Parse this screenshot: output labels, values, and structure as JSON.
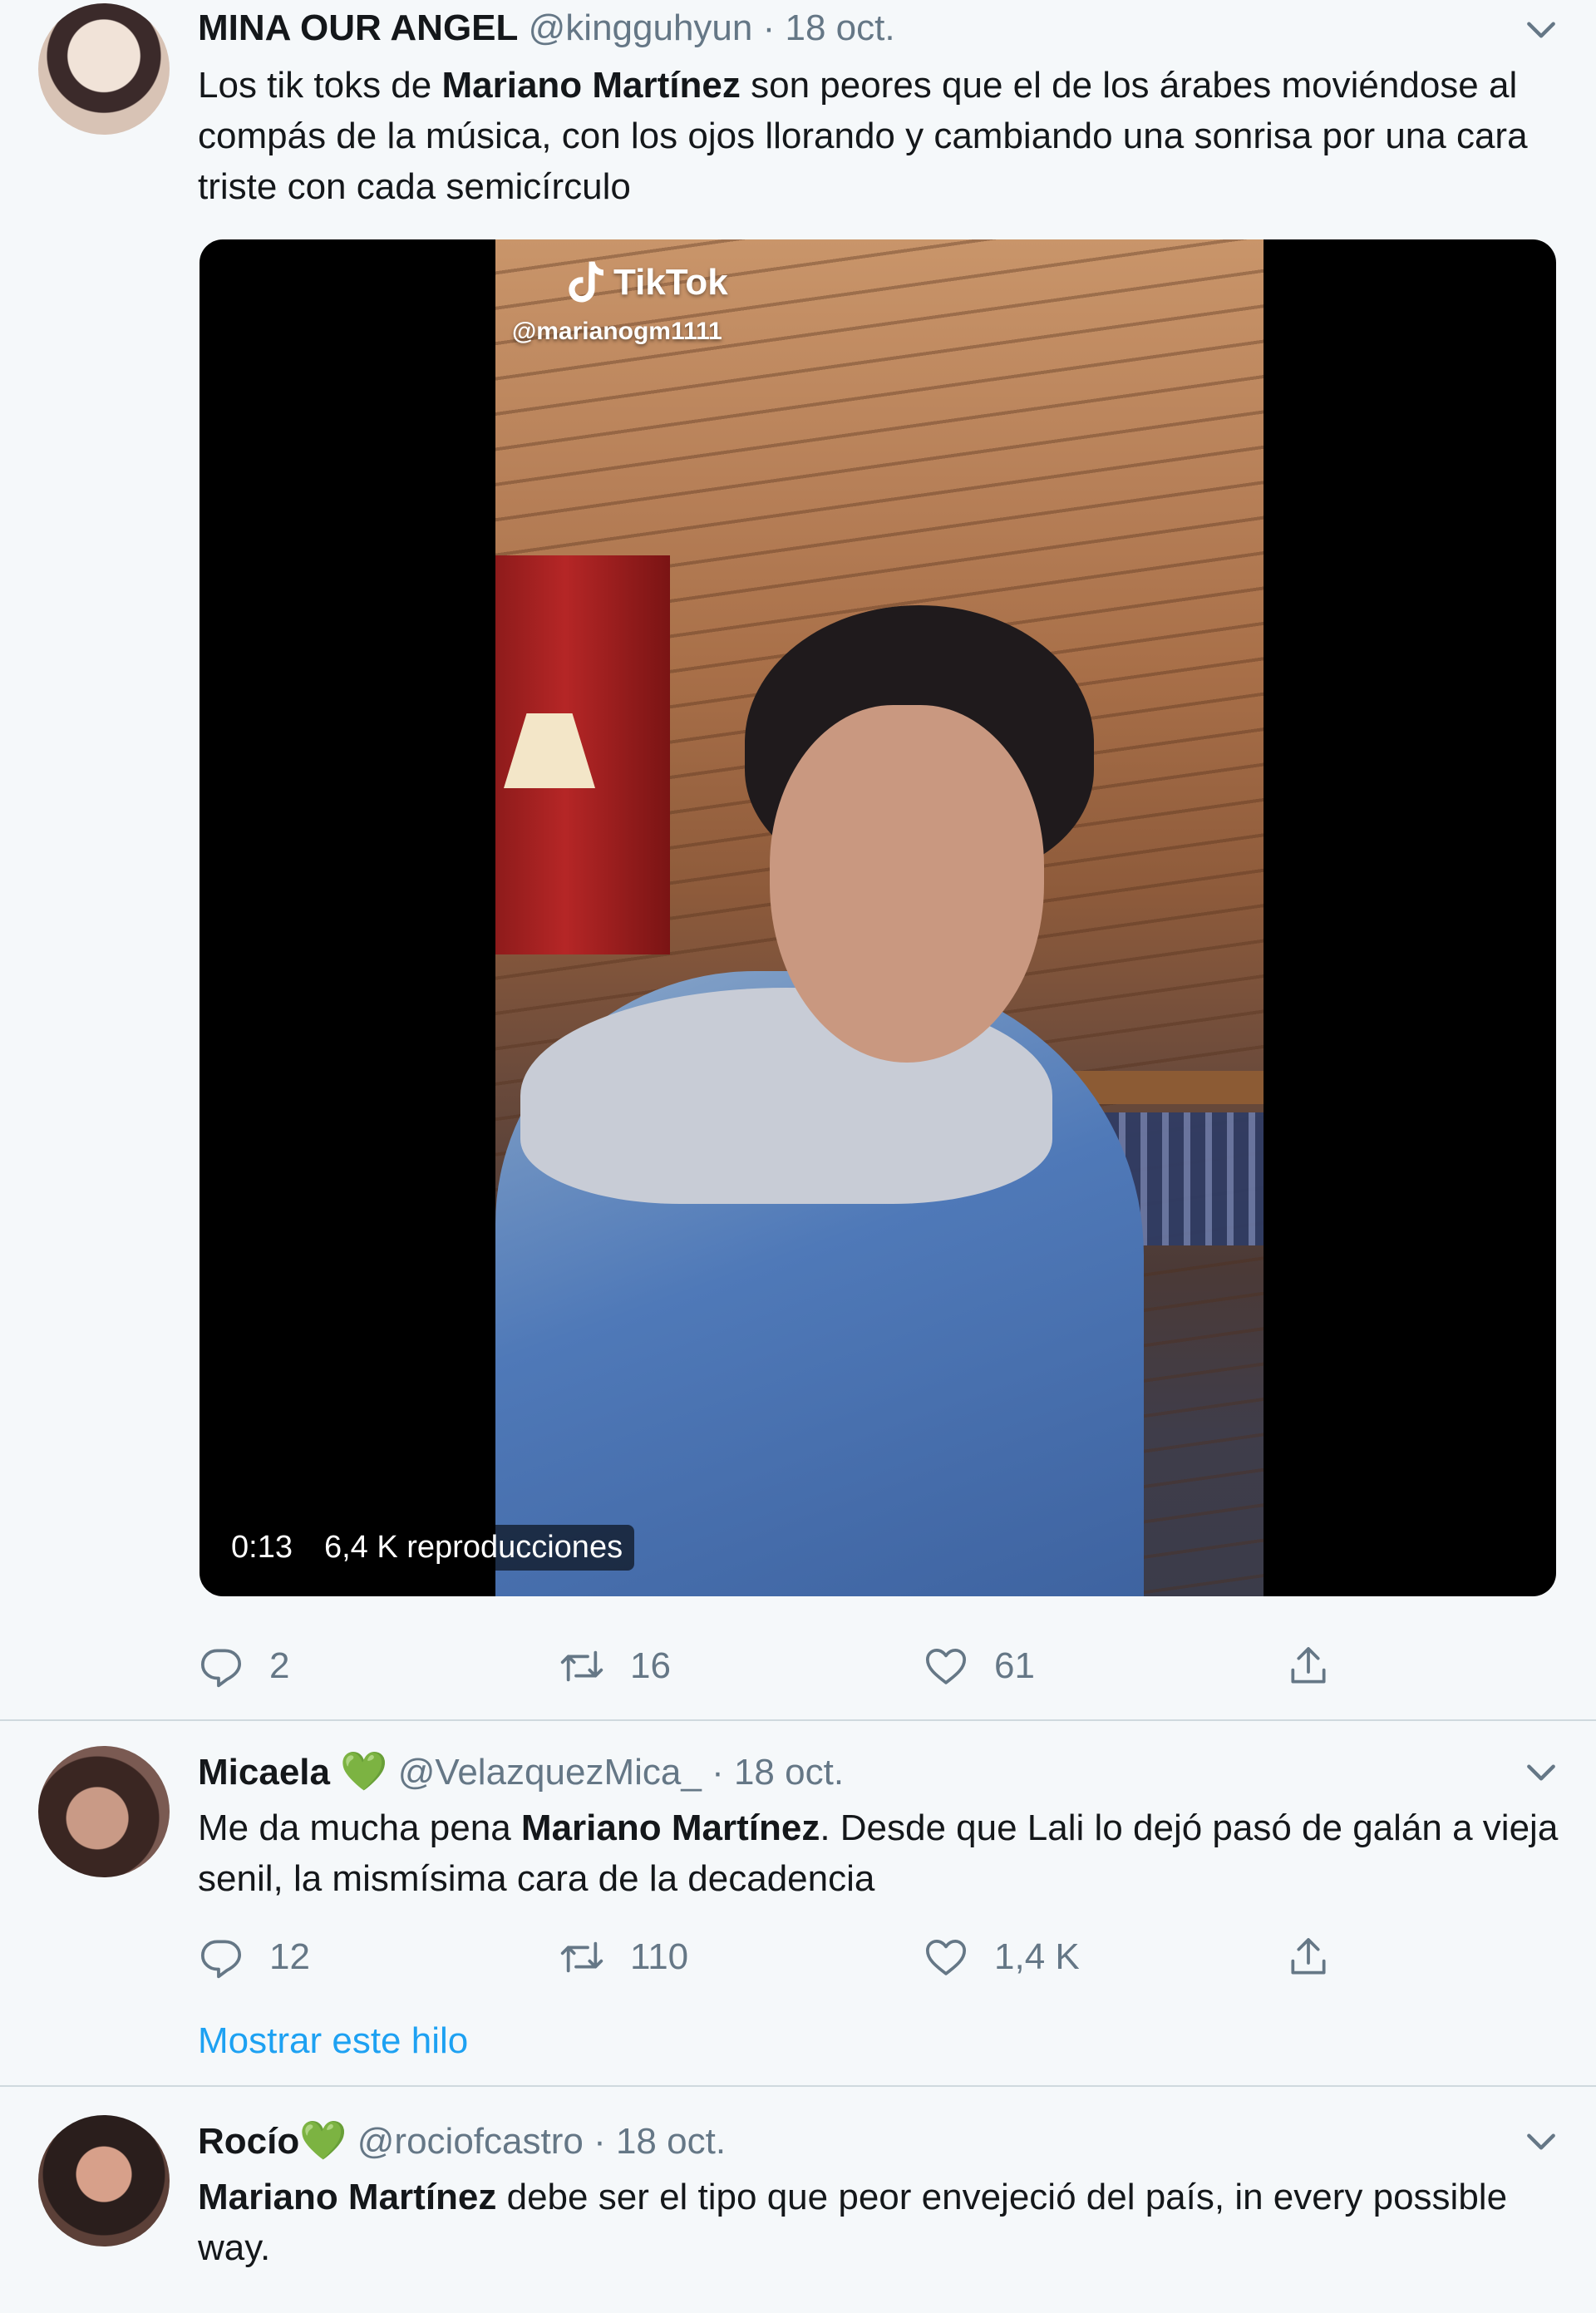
{
  "tweets": [
    {
      "name": "MINA OUR ANGEL",
      "handle": "@kingguhyun",
      "separator": "·",
      "date": "18 oct.",
      "text_parts": [
        {
          "text": "Los tik toks de ",
          "bold": false
        },
        {
          "text": "Mariano Martínez",
          "bold": true
        },
        {
          "text": " son peores que el de los árabes moviéndose al compás de la música, con los ojos llorando y cambiando una sonrisa por una cara triste con cada semicírculo",
          "bold": false
        }
      ],
      "media": {
        "tiktok_label": "TikTok",
        "tiktok_handle": "@marianogm1111",
        "duration": "0:13",
        "views": "6,4 K reproducciones"
      },
      "replies": "2",
      "retweets": "16",
      "likes": "61"
    },
    {
      "name": "Micaela",
      "badge": "💚",
      "handle": "@VelazquezMica_",
      "separator": "·",
      "date": "18 oct.",
      "text_parts": [
        {
          "text": "Me da mucha pena ",
          "bold": false
        },
        {
          "text": "Mariano Martínez",
          "bold": true
        },
        {
          "text": ". Desde que Lali lo dejó pasó de galán a vieja senil, la mismísima cara de la decadencia",
          "bold": false
        }
      ],
      "replies": "12",
      "retweets": "110",
      "likes": "1,4 K",
      "show_thread": "Mostrar este hilo"
    },
    {
      "name": "Rocío",
      "badge": "💚",
      "handle": "@rociofcastro",
      "separator": "·",
      "date": "18 oct.",
      "text_parts": [
        {
          "text": "Mariano Martínez",
          "bold": true
        },
        {
          "text": " debe ser el tipo que peor envejeció del país, in every possible way.",
          "bold": false
        }
      ]
    }
  ],
  "icons": {
    "reply": "speech-bubble-icon",
    "retweet": "retweet-icon",
    "like": "heart-icon",
    "share": "share-icon",
    "caret": "chevron-down-icon",
    "verified_heart": "green-heart-emoji"
  },
  "colors": {
    "background": "#f5f8fa",
    "text": "#14171a",
    "secondary": "#657786",
    "link": "#1da1f2",
    "green_heart": "#4caf50"
  }
}
